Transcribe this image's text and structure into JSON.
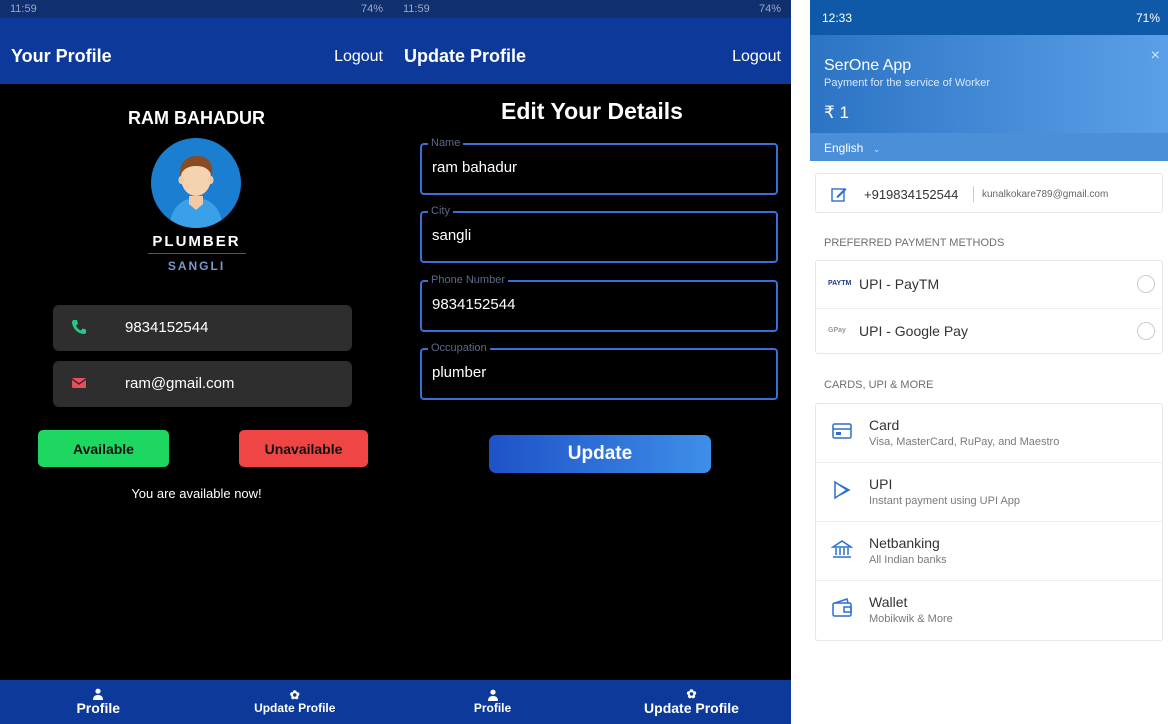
{
  "screen1": {
    "status_time": "11:59",
    "status_right": "74%",
    "appbar": {
      "title": "Your Profile",
      "logout": "Logout"
    },
    "name": "RAM BAHADUR",
    "occupation": "PLUMBER",
    "city": "SANGLI",
    "phone": "9834152544",
    "email": "ram@gmail.com",
    "available_label": "Available",
    "unavailable_label": "Unavailable",
    "status_message": "You are available now!",
    "nav": {
      "profile": "Profile",
      "update_profile": "Update Profile"
    },
    "icons": {
      "phone": "phone-icon",
      "mail": "mail-icon",
      "avatar": "person-avatar"
    },
    "colors": {
      "appbar": "#0d3a9a",
      "available": "#1ed760",
      "unavailable": "#f04545",
      "avatar_bg": "#1a7fd0"
    }
  },
  "screen2": {
    "status_time": "11:59",
    "status_right": "74%",
    "appbar": {
      "title": "Update Profile",
      "logout": "Logout"
    },
    "heading": "Edit Your Details",
    "fields": [
      {
        "label": "Name",
        "value": "ram bahadur"
      },
      {
        "label": "City",
        "value": "sangli"
      },
      {
        "label": "Phone Number",
        "value": "9834152544"
      },
      {
        "label": "Occupation",
        "value": "plumber"
      }
    ],
    "update_label": "Update",
    "nav": {
      "profile": "Profile",
      "update_profile": "Update Profile"
    },
    "colors": {
      "field_border": "#3b6fd8",
      "button": "#2b6fd8"
    }
  },
  "screen3": {
    "status_time": "12:33",
    "status_right": "71%",
    "app_name": "SerOne App",
    "description": "Payment for the service of Worker",
    "amount": "₹ 1",
    "close": "×",
    "language": "English",
    "contact_phone": "+919834152544",
    "contact_email": "kunalkokare789@gmail.com",
    "preferred_title": "PREFERRED PAYMENT METHODS",
    "preferred": [
      {
        "logo": "PAYTM",
        "label": "UPI - PayTM"
      },
      {
        "logo": "GPay",
        "label": "UPI - Google Pay"
      }
    ],
    "more_title": "CARDS, UPI & MORE",
    "options": [
      {
        "icon": "card-icon",
        "title": "Card",
        "subtitle": "Visa, MasterCard, RuPay, and Maestro"
      },
      {
        "icon": "upi-icon",
        "title": "UPI",
        "subtitle": "Instant payment using UPI App"
      },
      {
        "icon": "bank-icon",
        "title": "Netbanking",
        "subtitle": "All Indian banks"
      },
      {
        "icon": "wallet-icon",
        "title": "Wallet",
        "subtitle": "Mobikwik & More"
      }
    ],
    "colors": {
      "header_start": "#2c73c4",
      "header_end": "#5aa0e8",
      "status": "#0f5aa8"
    }
  }
}
